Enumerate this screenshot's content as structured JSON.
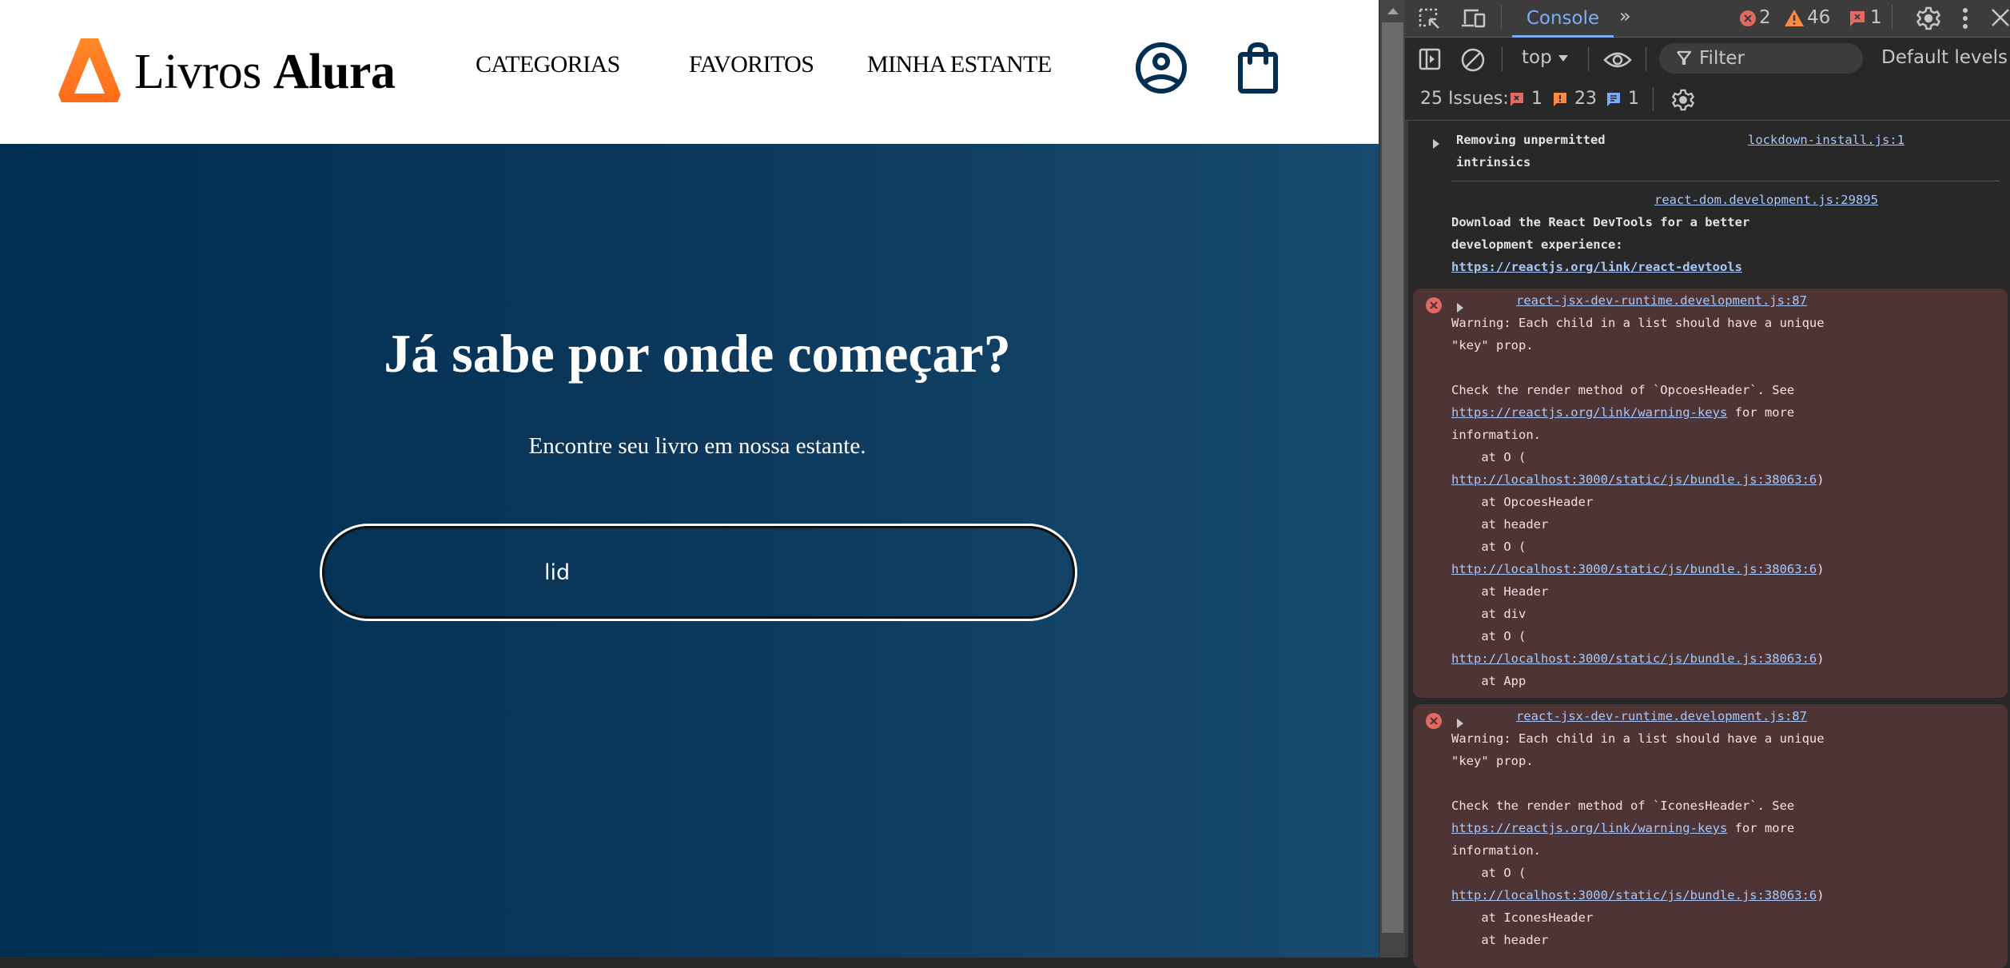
{
  "site": {
    "logo": {
      "name_regular": "Livros",
      "name_bold": "Alura",
      "brand_color": "#FF7E1D"
    },
    "nav": [
      {
        "label": "CATEGORIAS"
      },
      {
        "label": "FAVORITOS"
      },
      {
        "label": "MINHA ESTANTE"
      }
    ],
    "icons": {
      "profile": "profile-icon",
      "cart": "shopping-bag-icon",
      "icon_color": "#002F52"
    },
    "hero": {
      "title": "Já sabe por onde começar?",
      "subtitle": "Encontre seu livro em nossa estante.",
      "search_value": "lid",
      "gradient": [
        "#002F52",
        "#174A6E"
      ]
    }
  },
  "devtools": {
    "tabs": [
      {
        "label": "Console",
        "active": true
      }
    ],
    "more_tabs_glyph": "»",
    "counts": {
      "errors": "2",
      "warnings": "46",
      "issues": "1"
    },
    "context": "top",
    "filter_placeholder": "Filter",
    "levels": "Default levels",
    "issues_bar": {
      "label": "25 Issues:",
      "error": "1",
      "warning": "23",
      "info": "1"
    },
    "messages": [
      {
        "type": "info",
        "text_lines": [
          "Removing unpermitted",
          "intrinsics"
        ],
        "source": "lockdown-install.js:1"
      },
      {
        "type": "log",
        "source": "react-dom.development.js:29895",
        "text_lines": [
          "Download the React DevTools for a better",
          "development experience:"
        ],
        "link": "https://reactjs.org/link/react-devtools"
      },
      {
        "type": "error",
        "source": "react-jsx-dev-runtime.development.js:87",
        "line1": "Warning: Each child in a list should have a unique",
        "line2": "\"key\" prop.",
        "line3": "Check the render method of `OpcoesHeader`. See",
        "link_keys": "https://reactjs.org/link/warning-keys",
        "after_link": " for more",
        "line4": "information.",
        "stack": [
          {
            "text": "    at O ("
          },
          {
            "link": "http://localhost:3000/static/js/bundle.js:38063:6",
            "suffix": ")"
          },
          {
            "text": "    at OpcoesHeader"
          },
          {
            "text": "    at header"
          },
          {
            "text": "    at O ("
          },
          {
            "link": "http://localhost:3000/static/js/bundle.js:38063:6",
            "suffix": ")"
          },
          {
            "text": "    at Header"
          },
          {
            "text": "    at div"
          },
          {
            "text": "    at O ("
          },
          {
            "link": "http://localhost:3000/static/js/bundle.js:38063:6",
            "suffix": ")"
          },
          {
            "text": "    at App"
          }
        ]
      },
      {
        "type": "error",
        "source": "react-jsx-dev-runtime.development.js:87",
        "line1": "Warning: Each child in a list should have a unique",
        "line2": "\"key\" prop.",
        "line3": "Check the render method of `IconesHeader`. See",
        "link_keys": "https://reactjs.org/link/warning-keys",
        "after_link": " for more",
        "line4": "information.",
        "stack": [
          {
            "text": "    at O ("
          },
          {
            "link": "http://localhost:3000/static/js/bundle.js:38063:6",
            "suffix": ")"
          },
          {
            "text": "    at IconesHeader"
          },
          {
            "text": "    at header"
          }
        ]
      }
    ]
  }
}
